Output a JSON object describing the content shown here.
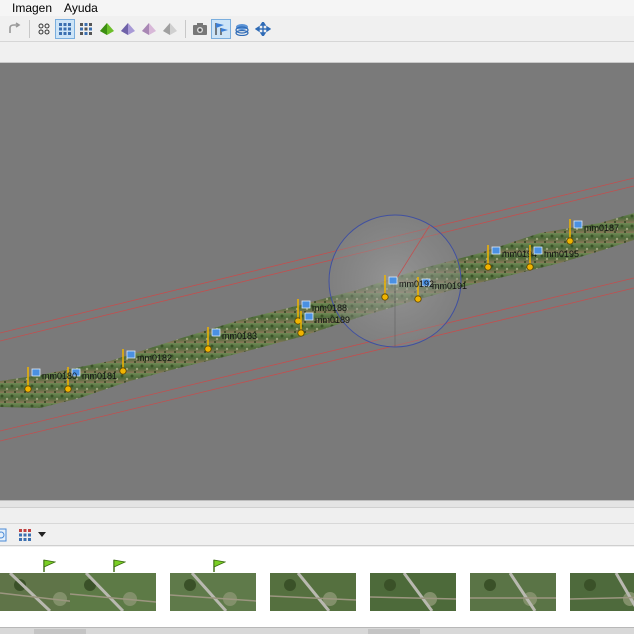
{
  "menu": {
    "items": [
      {
        "label": "Imagen"
      },
      {
        "label": "Ayuda"
      }
    ]
  },
  "toolbar": {
    "buttons": [
      {
        "icon": "redo-icon",
        "active": false
      },
      {
        "icon": "grid-4-dots-icon",
        "active": false
      },
      {
        "icon": "grid-9-dots-icon",
        "active": true
      },
      {
        "icon": "grid-checker-icon",
        "active": false
      },
      {
        "icon": "pyramid-green-icon",
        "active": false
      },
      {
        "icon": "pyramid-purple-icon",
        "active": false
      },
      {
        "icon": "pyramid-pink-icon",
        "active": false
      },
      {
        "icon": "pyramid-gray-icon",
        "active": false
      },
      {
        "icon": "camera-icon",
        "active": false
      },
      {
        "icon": "flags-icon",
        "active": true
      },
      {
        "icon": "layers-icon",
        "active": false
      },
      {
        "icon": "move-arrows-icon",
        "active": false
      }
    ]
  },
  "viewport": {
    "background": "#7a7a7a",
    "labels": [
      "mm0187",
      "mm0194",
      "mm0195",
      "mm0191",
      "mm0192",
      "mm0188",
      "mm0189",
      "mm0183",
      "mm0182",
      "mm0181",
      "mm0180"
    ]
  },
  "thumbnails": {
    "toolbar_icons": [
      "refresh-icon",
      "grid-view-icon"
    ],
    "items": [
      {
        "flag": true
      },
      {
        "flag": true
      },
      {
        "flag": true
      },
      {
        "flag": false
      },
      {
        "flag": false
      },
      {
        "flag": false
      },
      {
        "flag": false
      }
    ]
  },
  "colors": {
    "accent": "#7aaede",
    "marker": "#f0b400",
    "flag": "#4a90e2",
    "line": "#c05050"
  }
}
